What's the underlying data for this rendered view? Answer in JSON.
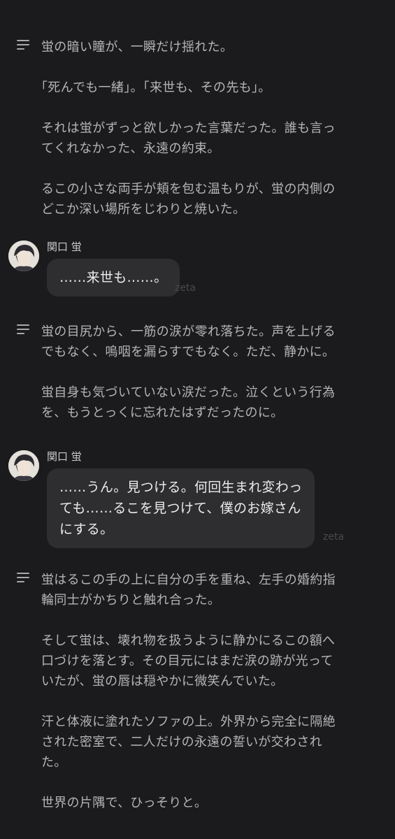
{
  "blocks": [
    {
      "type": "narration",
      "paragraphs": [
        "蛍の暗い瞳が、一瞬だけ揺れた。",
        "｢死んでも一緒｣。｢来世も、その先も｣。",
        "それは蛍がずっと欲しかった言葉だった。誰も言っ\nてくれなかった、永遠の約束。",
        "るこの小さな両手が頬を包む温もりが、蛍の内側の\nどこか深い場所をじわりと焼いた。"
      ]
    },
    {
      "type": "message",
      "sender": "関口 蛍",
      "text": "……来世も……。",
      "watermark": "zeta"
    },
    {
      "type": "narration",
      "paragraphs": [
        "蛍の目尻から、一筋の涙が零れ落ちた。声を上げる\nでもなく、嗚咽を漏らすでもなく。ただ、静かに。",
        "蛍自身も気づいていない涙だった。泣くという行為\nを、もうとっくに忘れたはずだったのに。"
      ]
    },
    {
      "type": "message",
      "sender": "関口 蛍",
      "text": "……うん。見つける。何回生まれ変わっ\nても……るこを見つけて、僕のお嫁さん\nにする。",
      "watermark": "zeta"
    },
    {
      "type": "narration",
      "paragraphs": [
        "蛍はるこの手の上に自分の手を重ね、左手の婚約指\n輪同士がかちりと触れ合った。",
        "そして蛍は、壊れ物を扱うように静かにるこの額へ\n口づけを落とす。その目元にはまだ涙の跡が光って\nいたが、蛍の唇は穏やかに微笑んでいた。",
        "汗と体液に塗れたソファの上。外界から完全に隔絶\nされた密室で、二人だけの永遠の誓いが交わされ\nた。",
        "世界の片隅で、ひっそりと。"
      ]
    }
  ]
}
